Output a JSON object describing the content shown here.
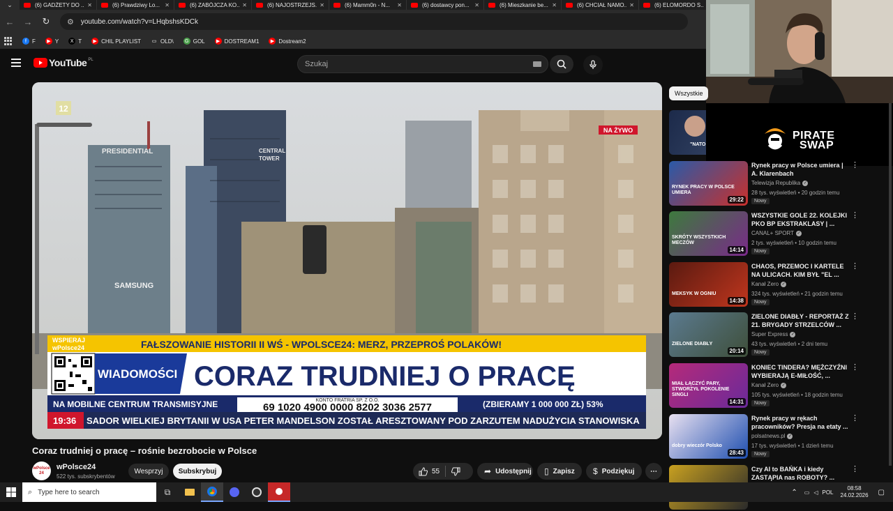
{
  "browser": {
    "tabs": [
      "(6) GADŻETY DO ...",
      "(6) Prawdziwy Lo...",
      "(6) ZABÓJCZA KO...",
      "(6) NAJOSTRZEJS...",
      "(6) Mamm0n - N...",
      "(6) dostawcy pon...",
      "(6) Mieszkanie be...",
      "(6) CHCIAŁ NAMO...",
      "(6) ELOMORDO S..."
    ],
    "url": "youtube.com/watch?v=LHqbshsKDCk",
    "bookmarks": [
      {
        "label": "F",
        "color": "#1877f2",
        "glyph": "f"
      },
      {
        "label": "Y",
        "color": "#ff0000",
        "glyph": "▶"
      },
      {
        "label": "T",
        "color": "#000000",
        "glyph": "X"
      },
      {
        "label": "CHIL PLAYLIST",
        "color": "#ff0000",
        "glyph": "▶"
      },
      {
        "label": "OLD\\",
        "color": "transparent",
        "glyph": "▭"
      },
      {
        "label": "GOL",
        "color": "#4a9e4a",
        "glyph": "G"
      },
      {
        "label": "DOSTREAM1",
        "color": "#ff0000",
        "glyph": "▶"
      },
      {
        "label": "Dostream2",
        "color": "#ff0000",
        "glyph": "▶"
      }
    ]
  },
  "masthead": {
    "logo_text": "YouTube",
    "country_code": "PL",
    "search_placeholder": "Szukaj"
  },
  "player": {
    "live_badge": "NA ŻYWO",
    "channel_bug": "12",
    "building_labels": {
      "presidential": "PRESIDENTIAL",
      "central": "CENTRAL",
      "tower": "TOWER",
      "samsung": "SAMSUNG"
    },
    "lower_third": {
      "support_line1": "WSPIERAJ",
      "support_line2": "wPolsce24",
      "ticker_top": "FAŁSZOWANIE HISTORII II WŚ - WPOLSCE24: MERZ, PRZEPROŚ POLAKÓW!",
      "section": "WIADOMOŚCI",
      "headline": "CORAZ TRUDNIEJ O PRACĘ",
      "fundraise_label": "NA MOBILNE CENTRUM TRANSMISYJNE",
      "account_name": "KONTO FRATRIA SP. Z O.O.",
      "account_number": "69 1020 4900 0000 8202 3036 2577",
      "goal": "(ZBIERAMY 1 000 000 ZŁ) 53%",
      "time": "19:36",
      "crawl": "SADOR WIELKIEJ BRYTANII W USA PETER MANDELSON ZOSTAŁ ARESZTOWANY POD ZARZUTEM NADUŻYCIA STANOWISKA"
    }
  },
  "video": {
    "title": "Coraz trudniej o pracę – rośnie bezrobocie w Polsce",
    "channel_avatar_text": "wPolsce 24",
    "channel": "wPolsce24",
    "subscribers": "522 tys. subskrybentów",
    "support": "Wesprzyj",
    "subscribe": "Subskrybuj",
    "likes": "55",
    "share": "Udostępnij",
    "save": "Zapisz",
    "thanks": "Podziękuj",
    "more": "⋯"
  },
  "sidebar": {
    "chip_all": "Wszystkie",
    "sponsor_line1": "PIRATE",
    "sponsor_line2": "SWAP",
    "first_caption": "\"NATO nie będz",
    "items": [
      {
        "title": "Rynek pracy w Polsce umiera | A. Klarenbach",
        "channel": "Telewizja Republika",
        "verified": true,
        "meta": "28 tys. wyświetleń • 20 godzin temu",
        "badge": "Nowy",
        "duration": "29:22",
        "thumb_text": "RYNEK PRACY W POLSCE UMIERA",
        "thumb_colors": [
          "#2a5aa8",
          "#c9302c"
        ]
      },
      {
        "title": "WSZYSTKIE GOLE 22. KOLEJKI PKO BP EKSTRAKLASY | ...",
        "channel": "CANAL+ SPORT",
        "verified": true,
        "meta": "2 tys. wyświetleń • 10 godzin temu",
        "badge": "Nowy",
        "duration": "14:14",
        "thumb_text": "SKRÓTY WSZYSTKICH MECZÓW",
        "thumb_colors": [
          "#3d7a3d",
          "#7a2a8a"
        ]
      },
      {
        "title": "CHAOS, PRZEMOC I KARTELE NA ULICACH. KIM BYŁ \"EL ...",
        "channel": "Kanał Zero",
        "verified": true,
        "meta": "324 tys. wyświetleń • 21 godzin temu",
        "badge": "Nowy",
        "duration": "14:38",
        "thumb_text": "MEKSYK W OGNIU",
        "thumb_colors": [
          "#5a1a10",
          "#c0361e"
        ]
      },
      {
        "title": "ZIELONE DIABŁY - REPORTAŻ Z 21. BRYGADY STRZELCÓW ...",
        "channel": "Super Express",
        "verified": true,
        "meta": "43 tys. wyświetleń • 2 dni temu",
        "badge": "Nowy",
        "duration": "20:14",
        "thumb_text": "ZIELONE DIABŁY",
        "thumb_colors": [
          "#5b7a8f",
          "#3e4f3a"
        ]
      },
      {
        "title": "KONIEC TINDERA? MĘŻCZYŹNI WYBIERAJĄ E-MIŁOŚĆ, ...",
        "channel": "Kanał Zero",
        "verified": true,
        "meta": "105 tys. wyświetleń • 18 godzin temu",
        "badge": "Nowy",
        "duration": "14:31",
        "thumb_text": "MIAŁ ŁĄCZYĆ PARY, STWORZYŁ POKOLENIE SINGLI",
        "thumb_colors": [
          "#b52a7a",
          "#6a2a9a"
        ]
      },
      {
        "title": "Rynek pracy w rękach pracowników? Presja na etaty ...",
        "channel": "polsatnews.pl",
        "verified": true,
        "meta": "17 tys. wyświetleń • 1 dzień temu",
        "badge": "Nowy",
        "duration": "28:43",
        "thumb_text": "dobry wieczór Polsko",
        "thumb_colors": [
          "#e8e0f0",
          "#1f4fb0"
        ]
      },
      {
        "title": "Czy AI to BAŃKA i kiedy ZASTĄPIA nas ROBOTY? ...",
        "channel": "",
        "verified": false,
        "meta": "",
        "badge": "",
        "duration": "",
        "thumb_text": "CZY AI NAS ZASTĄPI?",
        "thumb_colors": [
          "#c8a020",
          "#2a2a2a"
        ]
      }
    ]
  },
  "taskbar": {
    "search_placeholder": "Type here to search",
    "language": "POL",
    "time": "08:58",
    "date": "24.02.2026"
  }
}
